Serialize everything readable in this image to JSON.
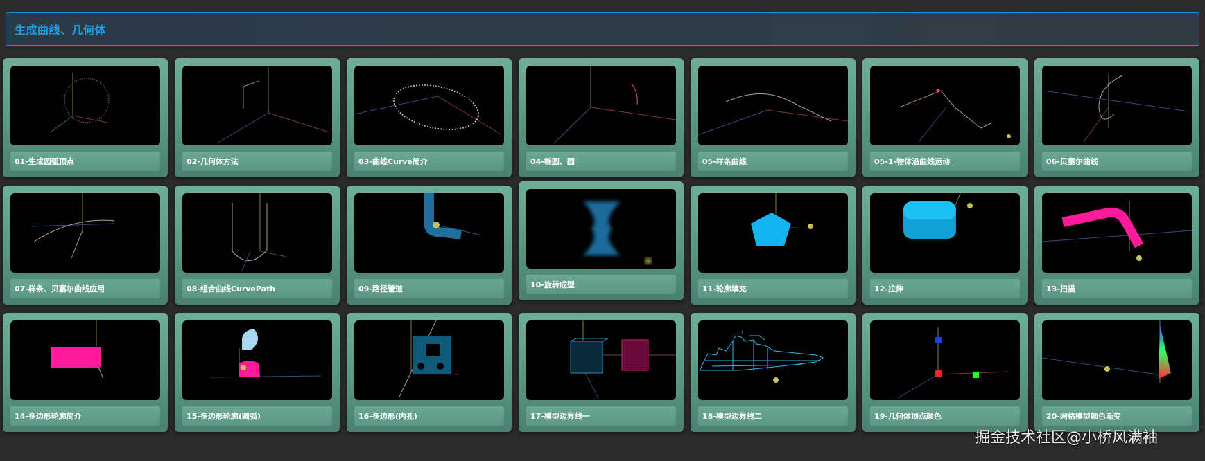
{
  "header": {
    "title": "生成曲线、几何体"
  },
  "cards": [
    {
      "label": "01-生成圆弧顶点"
    },
    {
      "label": "02-几何体方法"
    },
    {
      "label": "03-曲线Curve简介"
    },
    {
      "label": "04-椭圆、圆"
    },
    {
      "label": "05-样条曲线"
    },
    {
      "label": "05-1-物体沿曲线运动"
    },
    {
      "label": "06-贝塞尔曲线"
    },
    {
      "label": "07-样条、贝塞尔曲线应用"
    },
    {
      "label": "08-组合曲线CurvePath"
    },
    {
      "label": "09-路径管道"
    },
    {
      "label": "10-旋转成型"
    },
    {
      "label": "11-轮廓填充"
    },
    {
      "label": "12-拉伸"
    },
    {
      "label": "13-扫描"
    },
    {
      "label": "14-多边形轮廓简介"
    },
    {
      "label": "15-多边形轮廓(圆弧)"
    },
    {
      "label": "16-多边形(内孔)"
    },
    {
      "label": "17-模型边界线一"
    },
    {
      "label": "18-模型边界线二"
    },
    {
      "label": "19-几何体顶点颜色"
    },
    {
      "label": "20-网格模型颜色渐变"
    }
  ],
  "watermark": "掘金技术社区@小桥风满袖",
  "colors": {
    "accent": "#1aa0e8",
    "card": "#5a9784",
    "screen": "#000000"
  }
}
